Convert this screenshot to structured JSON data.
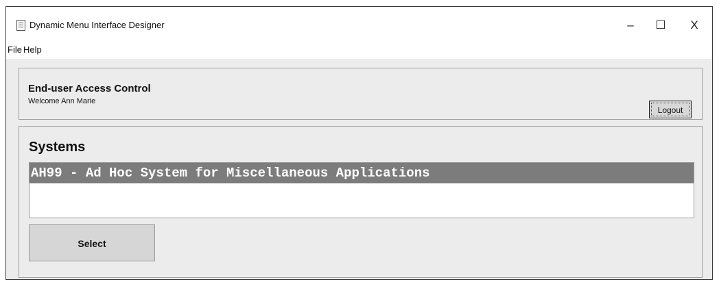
{
  "window": {
    "title": "Dynamic Menu Interface Designer",
    "icon": "java-cup-icon",
    "controls": {
      "minimize": "–",
      "maximize": "☐",
      "close": "X"
    }
  },
  "menubar": {
    "items": [
      "File",
      "Help"
    ]
  },
  "header": {
    "title": "End-user Access Control",
    "welcome": "Welcome Ann Marie",
    "logout_label": "Logout"
  },
  "systems": {
    "title": "Systems",
    "items": [
      {
        "label": "AH99 - Ad Hoc System for Miscellaneous Applications",
        "selected": true
      }
    ],
    "select_label": "Select"
  },
  "colors": {
    "selection": "#7c7c7c",
    "panel_background": "#ececec"
  }
}
